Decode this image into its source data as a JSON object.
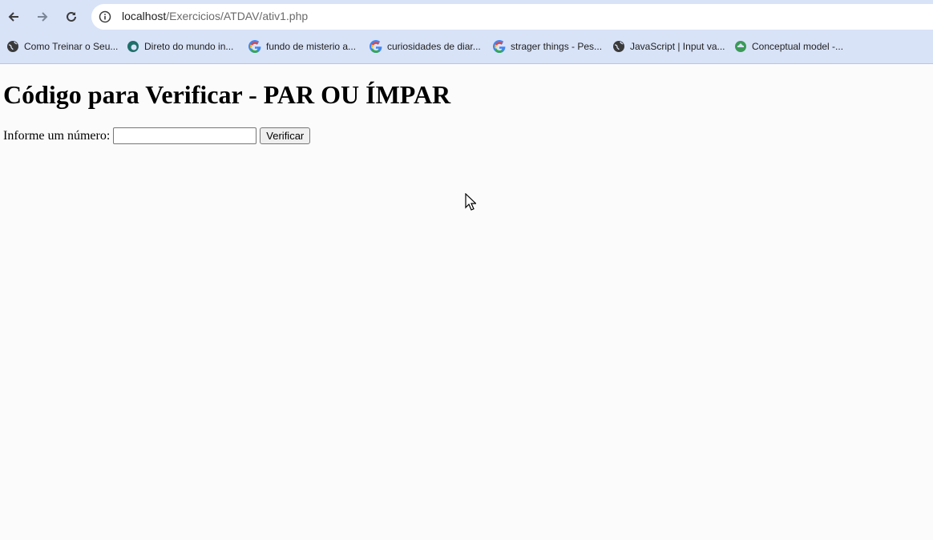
{
  "browser": {
    "url_host": "localhost",
    "url_path": "/Exercicios/ATDAV/ativ1.php",
    "nav": {
      "back_icon": "back-arrow-icon",
      "forward_icon": "forward-arrow-icon",
      "reload_icon": "reload-icon"
    },
    "bookmarks": [
      {
        "label": "Como Treinar o Seu...",
        "icon": "globe-icon"
      },
      {
        "label": "Direto do mundo in...",
        "icon": "site-logo-icon"
      },
      {
        "label": "fundo de misterio a...",
        "icon": "google-icon"
      },
      {
        "label": "curiosidades de diar...",
        "icon": "google-icon"
      },
      {
        "label": "strager things - Pes...",
        "icon": "google-icon"
      },
      {
        "label": "JavaScript | Input va...",
        "icon": "globe-icon"
      },
      {
        "label": "Conceptual model -...",
        "icon": "site-logo-icon"
      }
    ]
  },
  "page": {
    "title": "Código para Verificar - PAR OU ÍMPAR",
    "form": {
      "label": "Informe um número:",
      "input_value": "",
      "button_label": "Verificar"
    }
  },
  "colors": {
    "chrome_bg": "#d8e3f8",
    "page_bg": "#fbfbfb"
  }
}
